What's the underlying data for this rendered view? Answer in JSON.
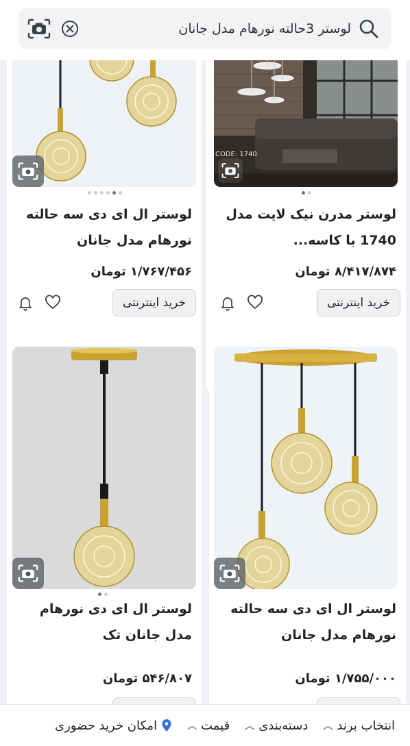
{
  "search": {
    "query": "لوستر 3حالته نورهام مدل جانان"
  },
  "products": [
    {
      "title": "لوستر مدرن نیک لایت مدل 1740 با کاسه...",
      "price": "۸/۴۱۷/۸۷۴ تومان",
      "image_code": "CODE: 1740",
      "buy_label": "خرید اینترنتی"
    },
    {
      "title": "لوستر ال ای دی سه حالته نورهام مدل جانان",
      "price": "۱/۷۶۷/۴۵۶ تومان",
      "buy_label": "خرید اینترنتی"
    },
    {
      "title": "لوستر ال ای دی سه حالته نورهام مدل جانان",
      "price": "۱/۷۵۵/۰۰۰ تومان"
    },
    {
      "title": "لوستر ال ای دی نورهام مدل جانان تک",
      "price": "۵۴۶/۸۰۷ تومان"
    }
  ],
  "filters": [
    {
      "label": "انتخاب برند"
    },
    {
      "label": "دسته‌بندی"
    },
    {
      "label": "قیمت"
    },
    {
      "label": "امکان خرید حضوری"
    }
  ],
  "colors": {
    "background": "#eef0f3",
    "card": "#ffffff",
    "gold": "#c9a232"
  }
}
